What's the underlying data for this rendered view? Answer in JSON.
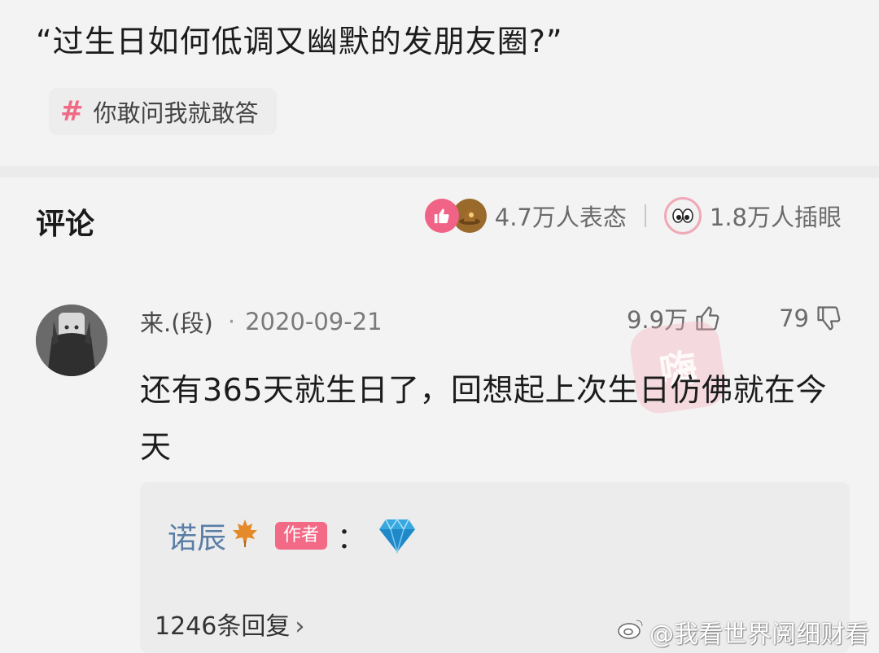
{
  "question": {
    "title": "“过生日如何低调又幽默的发朋友圈?”",
    "topic": "你敢问我就敢答"
  },
  "comments_header": {
    "heading": "评论",
    "reactions_count": "4.7万人表态",
    "eye_count": "1.8万人插眼",
    "colors": {
      "like": "#f06386",
      "hat": "#9a6a2c",
      "eye_border": "#f0a8b6"
    },
    "icons": [
      "thumbs-up-icon",
      "hat-icon",
      "eyes-icon"
    ]
  },
  "comment": {
    "username": "来.(段)",
    "date": "2020-09-21",
    "likes": "9.9万",
    "dislikes": "79",
    "text": "还有365天就生日了，回想起上次生日仿佛就在今天",
    "watermark_text": "嗨"
  },
  "reply": {
    "name": "诺辰",
    "badge": "作者",
    "colon": "：",
    "icons": [
      "maple-leaf-icon",
      "diamond-icon"
    ],
    "reply_count": "1246条回复",
    "badge_color": "#f26a86",
    "name_color": "#5a7ea6"
  },
  "watermark": {
    "text": "@我看世界阅细财看"
  }
}
